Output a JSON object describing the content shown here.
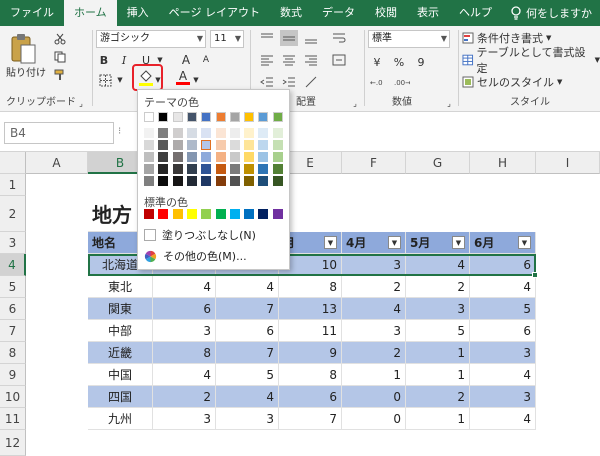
{
  "tabs": [
    "ファイル",
    "ホーム",
    "挿入",
    "ページ レイアウト",
    "数式",
    "データ",
    "校閲",
    "表示",
    "ヘルプ"
  ],
  "active_tab": "ホーム",
  "tell_me": "何をしますか",
  "ribbon": {
    "paste_label": "貼り付け",
    "clipboard_label": "クリップボード",
    "font_name": "游ゴシック",
    "font_size": "11",
    "bold": "B",
    "italic": "I",
    "underline": "U",
    "grow_font": "A",
    "shrink_font": "A",
    "font_color_letter": "A",
    "alignment_label": "配置",
    "number_format": "標準",
    "number_label": "数値",
    "currency": "¥",
    "percent": "%",
    "comma": "9",
    "conditional_format": "条件付き書式",
    "format_as_table": "テーブルとして書式設定",
    "cell_styles": "セルのスタイル",
    "styles_label": "スタイル",
    "fill_color": "#ffff00",
    "font_color": "#ff0000"
  },
  "formula_bar": {
    "name_box": "B4"
  },
  "columns": [
    "A",
    "B",
    "C",
    "D",
    "E",
    "F",
    "G",
    "H",
    "I"
  ],
  "rows": [
    "1",
    "2",
    "3",
    "4",
    "5",
    "6",
    "7",
    "8",
    "9",
    "10",
    "11",
    "12"
  ],
  "table": {
    "title": "地方",
    "headers": [
      "地名",
      "",
      "",
      "月",
      "4月",
      "5月",
      "6月"
    ],
    "data": [
      [
        "北海道",
        "",
        "",
        "10",
        "3",
        "4",
        "6"
      ],
      [
        "東北",
        "4",
        "4",
        "8",
        "2",
        "2",
        "4"
      ],
      [
        "関東",
        "6",
        "7",
        "13",
        "4",
        "3",
        "5"
      ],
      [
        "中部",
        "3",
        "6",
        "11",
        "3",
        "5",
        "6"
      ],
      [
        "近畿",
        "8",
        "7",
        "9",
        "2",
        "1",
        "3"
      ],
      [
        "中国",
        "4",
        "5",
        "8",
        "1",
        "1",
        "4"
      ],
      [
        "四国",
        "2",
        "4",
        "6",
        "0",
        "2",
        "3"
      ],
      [
        "九州",
        "3",
        "3",
        "7",
        "0",
        "1",
        "4"
      ]
    ]
  },
  "fill_popup": {
    "theme_colors_label": "テーマの色",
    "standard_colors_label": "標準の色",
    "no_fill": "塗りつぶしなし(N)",
    "more_colors": "その他の色(M)...",
    "theme_top": [
      "#ffffff",
      "#000000",
      "#e7e6e6",
      "#44546a",
      "#4472c4",
      "#ed7d31",
      "#a5a5a5",
      "#ffc000",
      "#5b9bd5",
      "#70ad47"
    ],
    "theme_shades": [
      [
        "#f2f2f2",
        "#7f7f7f",
        "#d0cece",
        "#d6dce4",
        "#d9e2f3",
        "#fbe5d5",
        "#ededed",
        "#fff2cc",
        "#deebf6",
        "#e2efd9"
      ],
      [
        "#d8d8d8",
        "#595959",
        "#aeabab",
        "#adb9ca",
        "#b4c6e7",
        "#f7cbac",
        "#dbdbdb",
        "#fee599",
        "#bdd7ee",
        "#c5e0b3"
      ],
      [
        "#bfbfbf",
        "#3f3f3f",
        "#757070",
        "#8496b0",
        "#8eaadb",
        "#f4b183",
        "#c9c9c9",
        "#ffd965",
        "#9cc3e5",
        "#a8d08d"
      ],
      [
        "#a5a5a5",
        "#262626",
        "#3a3838",
        "#323f4f",
        "#2f5496",
        "#c55a11",
        "#7b7b7b",
        "#bf9000",
        "#2e75b5",
        "#538135"
      ],
      [
        "#7f7f7f",
        "#0c0c0c",
        "#171616",
        "#222a35",
        "#1f3864",
        "#833c0b",
        "#525252",
        "#7f6000",
        "#1e4e79",
        "#375623"
      ]
    ],
    "standard": [
      "#c00000",
      "#ff0000",
      "#ffc000",
      "#ffff00",
      "#92d050",
      "#00b050",
      "#00b0f0",
      "#0070c0",
      "#002060",
      "#7030a0"
    ]
  }
}
